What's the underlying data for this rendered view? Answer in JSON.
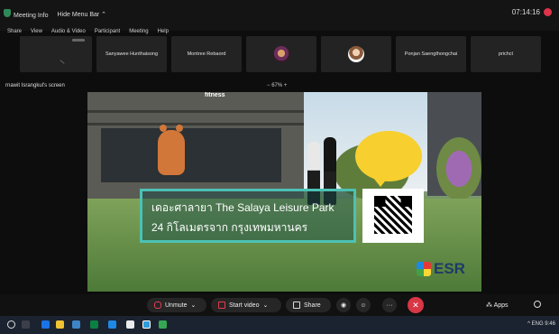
{
  "topbar": {
    "meeting_info": "Meeting Info",
    "hide_menu_bar": "Hide Menu Bar",
    "time": "07:14:16"
  },
  "menubar": [
    "Share",
    "View",
    "Audio & Video",
    "Participant",
    "Meeting",
    "Help"
  ],
  "participants": [
    {
      "name": "",
      "kind": "blank"
    },
    {
      "name": "Sanyawee Hunthaisong",
      "kind": "name"
    },
    {
      "name": "Montree Rebaord",
      "kind": "name"
    },
    {
      "name": "",
      "kind": "avatar1"
    },
    {
      "name": "",
      "kind": "avatar2"
    },
    {
      "name": "Ponjan Saengthongchai",
      "kind": "name"
    },
    {
      "name": "prichct",
      "kind": "name"
    }
  ],
  "share": {
    "title": "rnawit Israngkul's screen",
    "zoom": "67%",
    "zoom_minus": "−",
    "zoom_plus": "+"
  },
  "content": {
    "sign": "fitness",
    "caption_line1": "เดอะศาลายา The Salaya Leisure Park",
    "caption_line2": "24 กิโลเมตรจาก กรุงเทพมหานคร",
    "logo": "ESR"
  },
  "controls": {
    "unmute": "Unmute",
    "start_video": "Start video",
    "share": "Share",
    "more": "···",
    "apps": "Apps"
  },
  "taskbar": {
    "tray": "^  ENG  9:46"
  },
  "colors": {
    "leave_red": "#d93646",
    "accent_teal": "#4cc1b4",
    "bubble_yellow": "#f7cf2e"
  }
}
